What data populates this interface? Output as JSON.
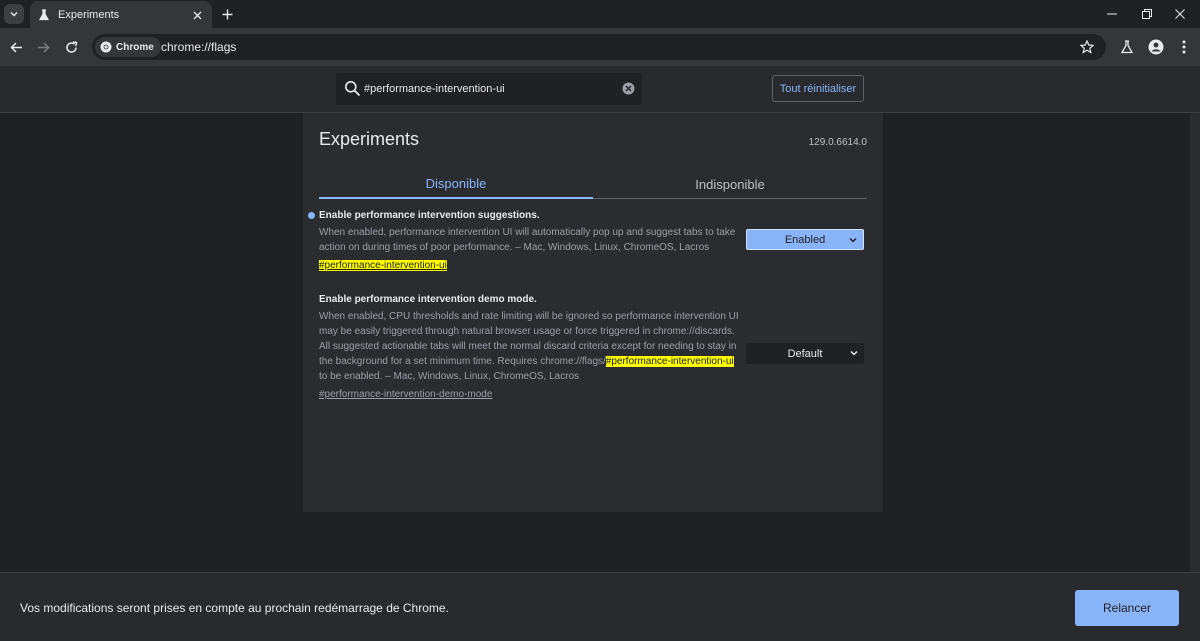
{
  "browser": {
    "tab_title": "Experiments",
    "chip_label": "Chrome",
    "url": "chrome://flags"
  },
  "flags_page": {
    "search_value": "#performance-intervention-ui",
    "reset_all_label": "Tout réinitialiser",
    "title": "Experiments",
    "version": "129.0.6614.0",
    "tabs": [
      {
        "label": "Disponible",
        "active": true
      },
      {
        "label": "Indisponible",
        "active": false
      }
    ],
    "flags": [
      {
        "name": "Enable performance intervention suggestions.",
        "description": "When enabled, performance intervention UI will automatically pop up and suggest tabs to take action on during times of poor performance. – Mac, Windows, Linux, ChromeOS, Lacros",
        "link": "#performance-intervention-ui",
        "selected": "Enabled"
      },
      {
        "name": "Enable performance intervention demo mode.",
        "description_before": "When enabled, CPU thresholds and rate limiting will be ignored so performance intervention UI may be easily triggered through natural browser usage or force triggered in chrome://discards. All suggested actionable tabs will meet the normal discard criteria except for needing to stay in the background for a set minimum time. Requires chrome://flags/",
        "description_highlight": "#performance-intervention-ui",
        "description_after": " to be enabled. – Mac, Windows, Linux, ChromeOS, Lacros",
        "link": "#performance-intervention-demo-mode",
        "selected": "Default"
      }
    ]
  },
  "bottom_bar": {
    "message": "Vos modifications seront prises en compte au prochain redémarrage de Chrome.",
    "relaunch_label": "Relancer"
  },
  "colors": {
    "accent": "#8ab4f8",
    "highlight": "#ffff00",
    "background": "#202124"
  }
}
